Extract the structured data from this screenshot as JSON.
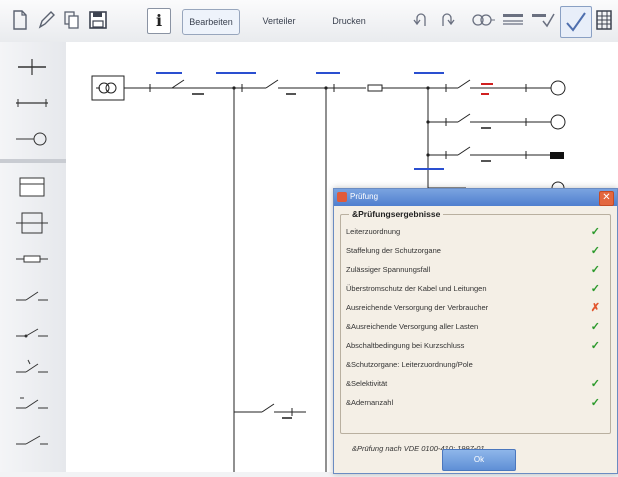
{
  "toolbar": {
    "icons": [
      "new-file-icon",
      "pencil-icon",
      "copy-icon",
      "save-icon"
    ],
    "info_label": "i",
    "buttons": [
      "Bearbeiten",
      "Verteiler",
      "Drucken"
    ],
    "right_icons": [
      "undo-icon",
      "redo-icon",
      "network-icon",
      "cable-icon",
      "check-mark-icon",
      "table-icon"
    ]
  },
  "dialog": {
    "title": "Prüfung",
    "close": "✕",
    "group_title": "&Prüfungsergebnisse",
    "results": [
      {
        "label": "Leiterzuordnung",
        "status": "ok",
        "mark": "✓"
      },
      {
        "label": "Staffelung der Schutzorgane",
        "status": "ok",
        "mark": "✓"
      },
      {
        "label": "Zulässiger Spannungsfall",
        "status": "ok",
        "mark": "✓"
      },
      {
        "label": "Überstromschutz der Kabel und Leitungen",
        "status": "ok",
        "mark": "✓"
      },
      {
        "label": "Ausreichende Versorgung der Verbraucher",
        "status": "bad",
        "mark": "✗"
      },
      {
        "label": "&Ausreichende Versorgung aller Lasten",
        "status": "ok",
        "mark": "✓"
      },
      {
        "label": "Abschaltbedingung bei Kurzschluss",
        "status": "ok",
        "mark": "✓"
      },
      {
        "label": "&Schutzorgane: Leiterzuordnung/Pole",
        "status": "none",
        "mark": ""
      },
      {
        "label": "&Selektivität",
        "status": "ok",
        "mark": "✓"
      },
      {
        "label": "&Adernanzahl",
        "status": "ok",
        "mark": "✓"
      }
    ],
    "note": "&Prüfung nach VDE 0100-410: 1997-01",
    "ok_label": "Ok"
  },
  "colors": {
    "ok": "#2c9a2c",
    "bad": "#e2552d",
    "accent": "#4f7fcf"
  }
}
